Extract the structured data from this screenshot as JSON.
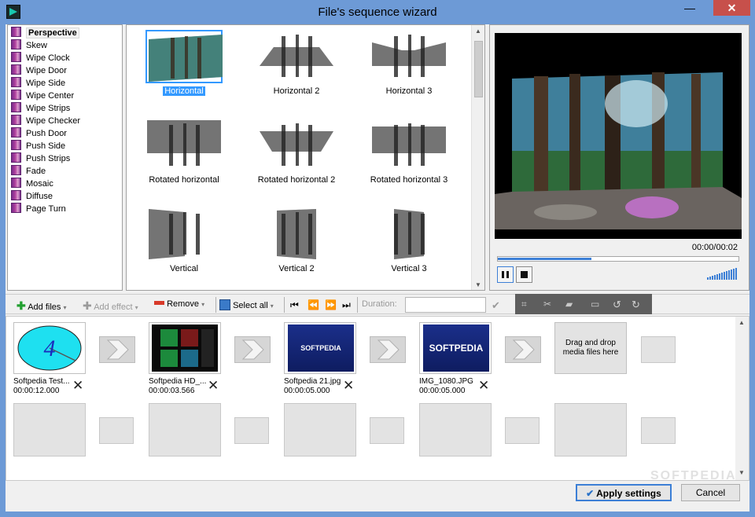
{
  "window": {
    "title": "File's sequence wizard",
    "minimize": "—",
    "maximize": "☐",
    "close": "✕"
  },
  "effects": [
    "Perspective",
    "Skew",
    "Wipe Clock",
    "Wipe Door",
    "Wipe Side",
    "Wipe Center",
    "Wipe Strips",
    "Wipe Checker",
    "Push Door",
    "Push Side",
    "Push Strips",
    "Fade",
    "Mosaic",
    "Diffuse",
    "Page Turn"
  ],
  "selected_effect": "Perspective",
  "transitions": [
    "Horizontal",
    "Horizontal 2",
    "Horizontal 3",
    "Rotated horizontal",
    "Rotated horizontal 2",
    "Rotated horizontal 3",
    "Vertical",
    "Vertical 2",
    "Vertical 3"
  ],
  "selected_transition": "Horizontal",
  "player": {
    "time": "00:00/00:02",
    "progress": 0.39
  },
  "toolbar": {
    "add_files": "Add files",
    "add_effect": "Add effect",
    "remove": "Remove",
    "select_all": "Select all",
    "duration_label": "Duration:",
    "duration_value": ""
  },
  "clips": [
    {
      "name": "Softpedia Test...",
      "duration": "00:00:12.000",
      "thumb": "clock-icon",
      "digit": "4"
    },
    {
      "name": "Softpedia HD_...",
      "duration": "00:00:03.566",
      "thumb": "film-thumb"
    },
    {
      "name": "Softpedia 21.jpg",
      "duration": "00:00:05.000",
      "thumb": "logo-thumb",
      "logo": "SOFTPEDIA"
    },
    {
      "name": "IMG_1080.JPG",
      "duration": "00:00:05.000",
      "thumb": "logo-thumb",
      "logo": "SOFTPEDIA"
    }
  ],
  "dropzone": "Drag and drop media files here",
  "footer": {
    "apply": "Apply settings",
    "cancel": "Cancel"
  },
  "watermark": "SOFTPEDIA",
  "colors": {
    "titlebar": "#6d9ad6",
    "close": "#c7504b",
    "accent": "#3399ff"
  }
}
